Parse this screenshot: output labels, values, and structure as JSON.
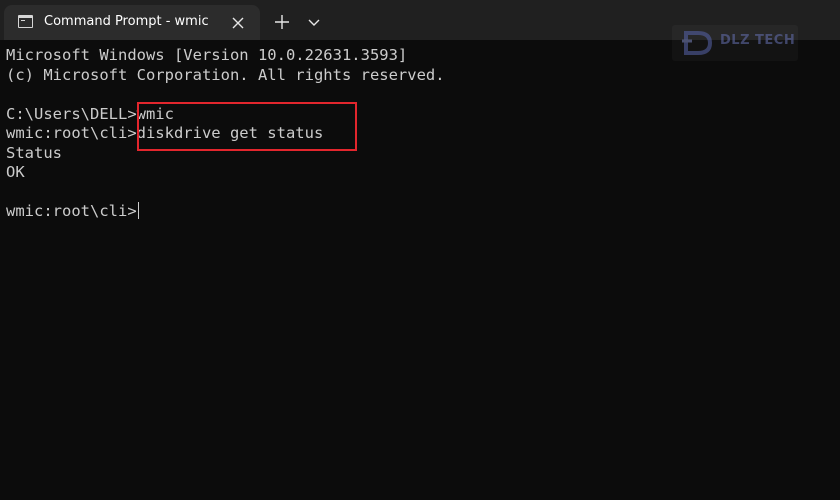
{
  "window": {
    "tab_title": "Command Prompt - wmic",
    "tab_icon": "console-icon",
    "close_icon": "close-icon",
    "new_tab_icon": "plus-icon",
    "dropdown_icon": "chevron-down-icon"
  },
  "watermark": {
    "logo_text": "DLZ TECH"
  },
  "console": {
    "lines": [
      "Microsoft Windows [Version 10.0.22631.3593]",
      "(c) Microsoft Corporation. All rights reserved.",
      "",
      "C:\\Users\\DELL>wmic",
      "wmic:root\\cli>diskdrive get status",
      "Status",
      "OK",
      "",
      "wmic:root\\cli>"
    ]
  },
  "colors": {
    "background": "#0c0c0c",
    "tabbar": "#202020",
    "active_tab": "#2c2c2c",
    "text": "#cccccc",
    "highlight_border": "#e3262d"
  }
}
